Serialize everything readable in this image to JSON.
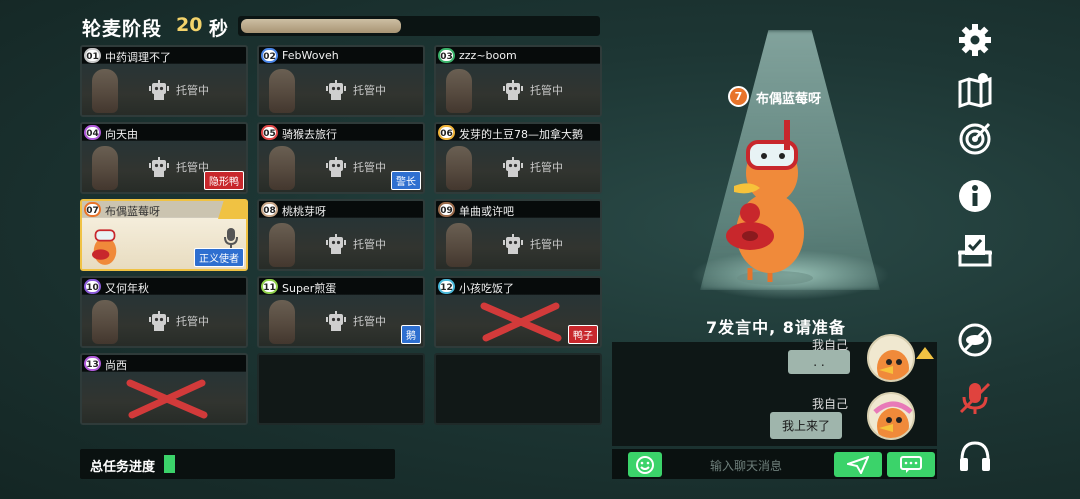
{
  "header": {
    "phase_title": "轮麦阶段",
    "countdown": "20",
    "unit": "秒",
    "timer_fraction": 0.45
  },
  "players": [
    {
      "num": "01",
      "name": "中药调理不了",
      "status": "托管中",
      "role": "",
      "num_color": "#c9c9c9",
      "state": "normal"
    },
    {
      "num": "02",
      "name": "FebWoveh",
      "status": "托管中",
      "role": "",
      "num_color": "#4a86e8",
      "state": "normal"
    },
    {
      "num": "03",
      "name": "zzz~boom",
      "status": "托管中",
      "role": "",
      "num_color": "#3bb26a",
      "state": "normal"
    },
    {
      "num": "04",
      "name": "向天由",
      "status": "托管中",
      "role": "隐形鸭",
      "role_color": "red",
      "num_color": "#b05ad9",
      "state": "normal"
    },
    {
      "num": "05",
      "name": "骑猴去旅行",
      "status": "托管中",
      "role": "警长",
      "role_color": "blue",
      "num_color": "#e04848",
      "state": "normal"
    },
    {
      "num": "06",
      "name": "发芽的土豆78—加拿大鹅",
      "status": "托管中",
      "role": "",
      "num_color": "#f0b43a",
      "state": "normal"
    },
    {
      "num": "07",
      "name": "布偶蓝莓呀",
      "status": "",
      "role": "正义使者",
      "role_color": "blue",
      "num_color": "#e8742a",
      "state": "active"
    },
    {
      "num": "08",
      "name": "桃桃芽呀",
      "status": "托管中",
      "role": "",
      "num_color": "#c9a88a",
      "state": "normal"
    },
    {
      "num": "09",
      "name": "单曲或许吧",
      "status": "托管中",
      "role": "",
      "num_color": "#9a6a4a",
      "state": "normal"
    },
    {
      "num": "10",
      "name": "又何年秋",
      "status": "托管中",
      "role": "",
      "num_color": "#8a5ad9",
      "state": "normal"
    },
    {
      "num": "11",
      "name": "Super煎蛋",
      "status": "托管中",
      "role": "鹅",
      "role_color": "blue",
      "num_color": "#8fd04a",
      "state": "normal"
    },
    {
      "num": "12",
      "name": "小孩吃饭了",
      "status": "",
      "role": "鸭子",
      "role_color": "red",
      "num_color": "#4ab8d9",
      "state": "dead"
    },
    {
      "num": "13",
      "name": "尚西",
      "status": "",
      "role": "",
      "num_color": "#b05ad9",
      "state": "dead"
    }
  ],
  "task": {
    "label": "总任务进度",
    "progress": 0.05
  },
  "speaker": {
    "num": "7",
    "name": "布偶蓝莓呀",
    "status_text": "7发言中, 8请准备"
  },
  "chat": {
    "messages": [
      {
        "sender": "我自己",
        "text": ". ."
      },
      {
        "sender": "我自己",
        "text": "我上来了"
      }
    ],
    "input_placeholder": "输入聊天消息"
  },
  "rail_icons": [
    "gear-icon",
    "map-icon",
    "target-icon",
    "info-icon",
    "vote-box-icon",
    "no-view-icon",
    "mic-off-icon",
    "headphones-icon"
  ],
  "colors": {
    "accent_green": "#3bd36a",
    "highlight_yellow": "#f0c243",
    "role_red": "#c8272c",
    "role_blue": "#2e6fd0"
  }
}
